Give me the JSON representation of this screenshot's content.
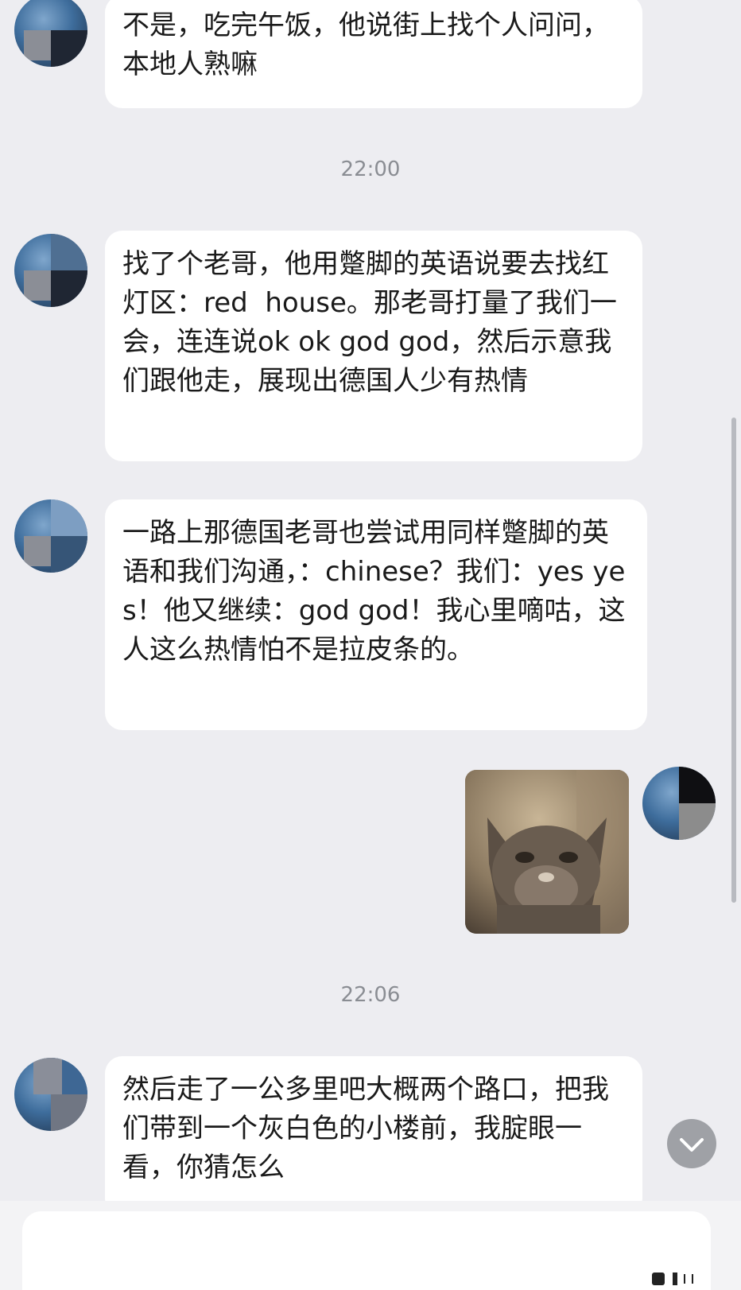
{
  "messages": [
    {
      "type": "received",
      "text": "不是，吃完午饭，他说街上找个人问问，本地人熟嘛"
    },
    {
      "type": "time",
      "text": "22:00"
    },
    {
      "type": "received",
      "text": "找了个老哥，他用蹩脚的英语说要去找红灯区：red  house。那老哥打量了我们一会，连连说ok ok god god，然后示意我们跟他走，展现出德国人少有热情"
    },
    {
      "type": "received",
      "text": "一路上那德国老哥也尝试用同样蹩脚的英语和我们沟通，：chinese？我们：yes yes！他又继续：god god！我心里嘀咕，这人这么热情怕不是拉皮条的。"
    },
    {
      "type": "sent-image",
      "image": "cat-meme"
    },
    {
      "type": "time",
      "text": "22:06"
    },
    {
      "type": "received",
      "text": "然后走了一公多里吧大概两个路口，把我们带到一个灰白色的小楼前，我腚眼一看，你猜怎么"
    }
  ],
  "scroll_button": {
    "icon": "chevron-down-icon"
  },
  "input_bar": {
    "icon": "input-icon"
  }
}
